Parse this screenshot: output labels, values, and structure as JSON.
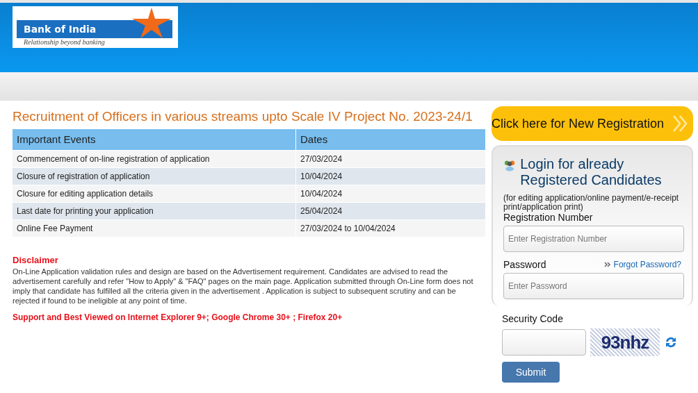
{
  "logo": {
    "name": "Bank of India",
    "tagline": "Relationship beyond banking"
  },
  "title": "Recruitment of Officers in various streams upto Scale IV Project No. 2023-24/1",
  "events_table": {
    "columns": [
      "Important Events",
      "Dates"
    ],
    "rows": [
      [
        "Commencement of on-line registration of application",
        "27/03/2024"
      ],
      [
        "Closure of registration of application",
        "10/04/2024"
      ],
      [
        "Closure for editing application details",
        "10/04/2024"
      ],
      [
        "Last date for printing your application",
        "25/04/2024"
      ],
      [
        "Online Fee Payment",
        "27/03/2024 to 10/04/2024"
      ]
    ]
  },
  "disclaimer": {
    "heading": "Disclaimer",
    "text": "On-Line Application validation rules and design are based on the Advertisement requirement. Candidates are advised to read the advertisement carefully and refer \"How to Apply\" & \"FAQ\" pages on the main page. Application submitted through On-Line form does not imply that candidate has fulfilled all the criteria given in the advertisement . Application is subject to subsequent scrutiny and can be rejected if found to be ineligible at any point of time."
  },
  "browser_note": "Support and Best Viewed on Internet Explorer 9+; Google Chrome 30+ ; Firefox 20+",
  "new_registration": "Click here for New Registration",
  "login": {
    "title": "Login for already Registered Candidates",
    "subtitle": "(for editing application/online payment/e-receipt print/application print)",
    "registration_label": "Registration Number",
    "registration_placeholder": "Enter Registration Number",
    "password_label": "Password",
    "forgot_link": "Forgot Password?",
    "password_placeholder": "Enter Password"
  },
  "security": {
    "label": "Security Code",
    "captcha": "93nhz"
  },
  "submit": "Submit"
}
